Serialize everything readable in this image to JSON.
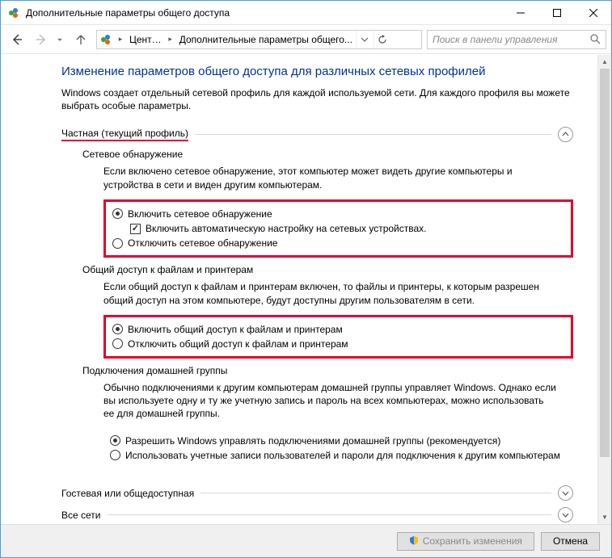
{
  "titlebar": {
    "title": "Дополнительные параметры общего доступа"
  },
  "nav": {
    "crumb1": "Цент…",
    "crumb2": "Дополнительные параметры общего...",
    "search_placeholder": "Поиск в панели управления"
  },
  "page": {
    "heading": "Изменение параметров общего доступа для различных сетевых профилей",
    "subtext": "Windows создает отдельный сетевой профиль для каждой используемой сети. Для каждого профиля вы можете выбрать особые параметры."
  },
  "profile_private": {
    "title": "Частная (текущий профиль)",
    "discovery": {
      "heading": "Сетевое обнаружение",
      "desc": "Если включено сетевое обнаружение, этот компьютер может видеть другие компьютеры и устройства в сети и виден другим компьютерам.",
      "opt_on": "Включить сетевое обнаружение",
      "opt_auto": "Включить автоматическую настройку на сетевых устройствах.",
      "opt_off": "Отключить сетевое обнаружение"
    },
    "fileshare": {
      "heading": "Общий доступ к файлам и принтерам",
      "desc": "Если общий доступ к файлам и принтерам включен, то файлы и принтеры, к которым разрешен общий доступ на этом компьютере, будут доступны другим пользователям в сети.",
      "opt_on": "Включить общий доступ к файлам и принтерам",
      "opt_off": "Отключить общий доступ к файлам и принтерам"
    },
    "homegroup": {
      "heading": "Подключения домашней группы",
      "desc": "Обычно подключениями к другим компьютерам домашней группы управляет Windows. Однако если вы используете одну и ту же учетную запись и пароль на всех компьютерах, можно использовать ее для домашней группы.",
      "opt_win": "Разрешить Windows управлять подключениями домашней группы (рекомендуется)",
      "opt_user": "Использовать учетные записи пользователей и пароли для подключения к другим компьютерам"
    }
  },
  "profile_guest": {
    "title": "Гостевая или общедоступная"
  },
  "profile_all": {
    "title": "Все сети"
  },
  "buttons": {
    "save": "Сохранить изменения",
    "cancel": "Отмена"
  }
}
